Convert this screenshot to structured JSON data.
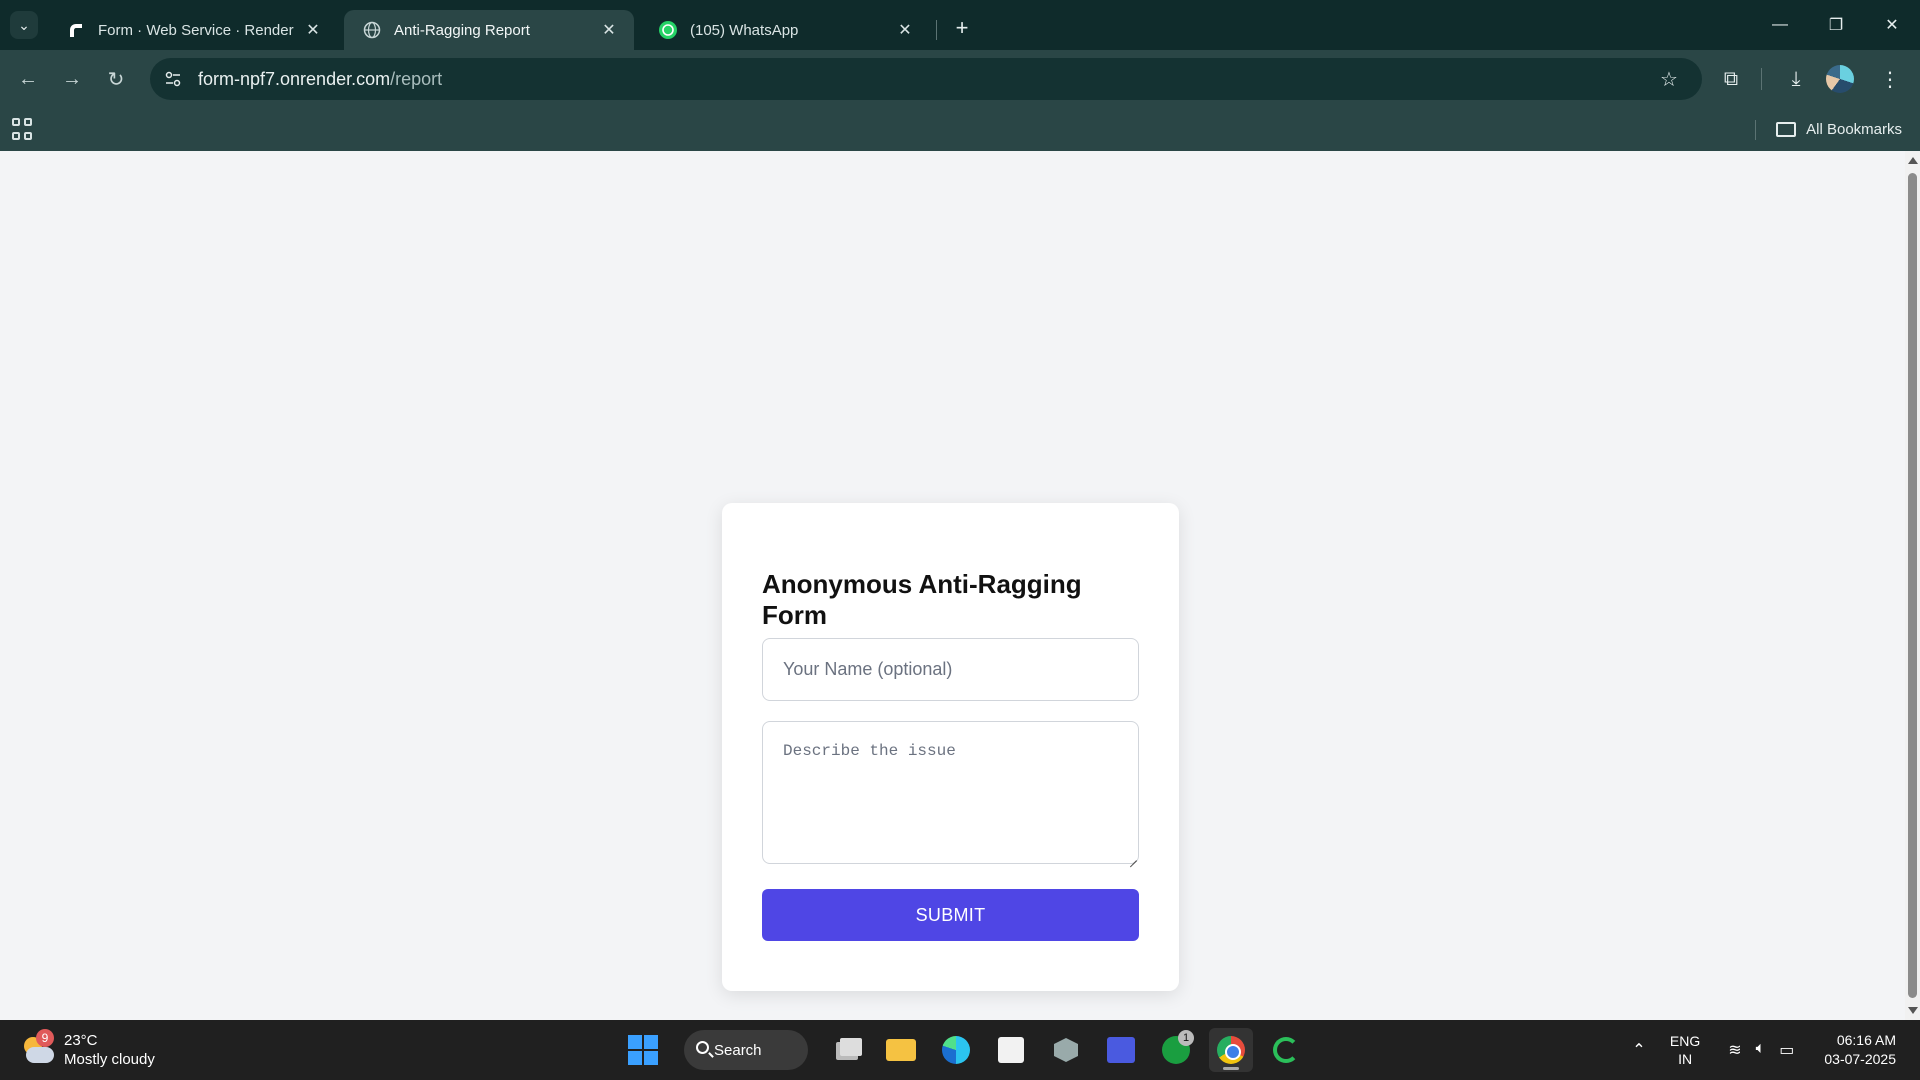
{
  "browser": {
    "tabs": [
      {
        "title": "Form · Web Service · Render D",
        "icon": "render-logo-icon",
        "active": false
      },
      {
        "title": "Anti-Ragging Report",
        "icon": "globe-icon",
        "active": true
      },
      {
        "title": "(105) WhatsApp",
        "icon": "whatsapp-icon",
        "active": false
      }
    ],
    "url_host": "form-npf7.onrender.com",
    "url_path": "/report",
    "bookmarks_label": "All Bookmarks"
  },
  "form": {
    "title": "Anonymous Anti-Ragging Form",
    "name_placeholder": "Your Name (optional)",
    "name_value": "",
    "issue_placeholder": "Describe the issue",
    "issue_value": "",
    "submit_label": "SUBMIT",
    "accent_color": "#4f46e5"
  },
  "taskbar": {
    "weather": {
      "temperature": "23°C",
      "condition": "Mostly cloudy",
      "badge": "9"
    },
    "search_label": "Search",
    "xbox_badge": "1",
    "language": {
      "line1": "ENG",
      "line2": "IN"
    },
    "time": "06:16 AM",
    "date": "03-07-2025"
  }
}
